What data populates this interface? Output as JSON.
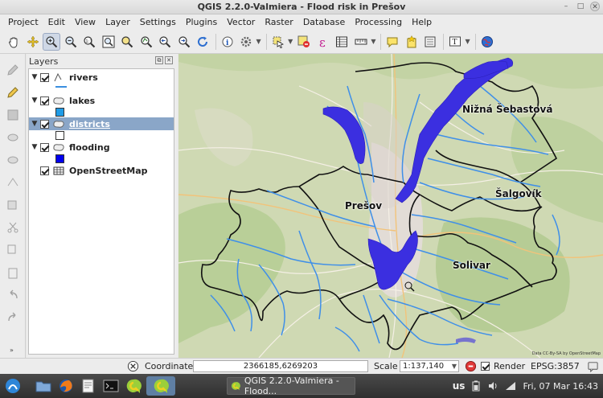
{
  "window": {
    "title": "QGIS 2.2.0-Valmiera - Flood risk in Prešov"
  },
  "menu": [
    "Project",
    "Edit",
    "View",
    "Layer",
    "Settings",
    "Plugins",
    "Vector",
    "Raster",
    "Database",
    "Processing",
    "Help"
  ],
  "layers_panel": {
    "title": "Layers",
    "layers": [
      {
        "name": "rivers",
        "checked": true,
        "type": "line",
        "legend_color": "#3a8fe0"
      },
      {
        "name": "lakes",
        "checked": true,
        "type": "polygon",
        "legend_color": "#1e9be6"
      },
      {
        "name": "districts",
        "checked": true,
        "type": "polygon",
        "selected": true,
        "legend_color": "#ffffff"
      },
      {
        "name": "flooding",
        "checked": true,
        "type": "polygon",
        "legend_color": "#0000ee"
      },
      {
        "name": "OpenStreetMap",
        "checked": true,
        "type": "raster"
      }
    ]
  },
  "map": {
    "labels": [
      "Nižná Šebastová",
      "Šalgovík",
      "Prešov",
      "Solivar"
    ],
    "attribution": "Data CC-By-SA by OpenStreetMap",
    "colors": {
      "flood": "#3b2fe0",
      "river": "#3f8fe8",
      "district": "#000000",
      "background": "#cfd9b3"
    }
  },
  "statusbar": {
    "coordinate_label": "Coordinate:",
    "coordinate_value": "2366185,6269203",
    "scale_label": "Scale",
    "scale_value": "1:137,140",
    "render_label": "Render",
    "render_checked": true,
    "crs": "EPSG:3857"
  },
  "taskbar": {
    "task_label": "QGIS 2.2.0-Valmiera - Flood...",
    "keyboard_layout": "us",
    "datetime": "Fri, 07 Mar 16:43"
  }
}
